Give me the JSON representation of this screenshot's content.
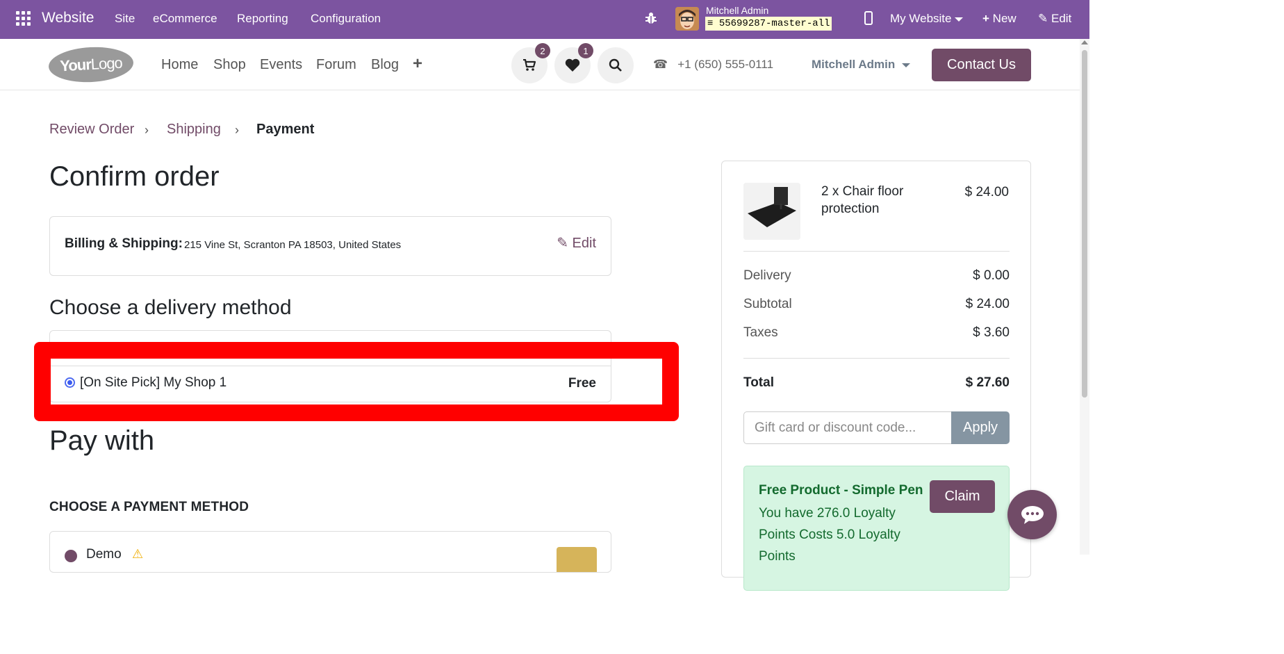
{
  "adminbar": {
    "brand": "Website",
    "menus": [
      "Site",
      "eCommerce",
      "Reporting",
      "Configuration"
    ],
    "user_name": "Mitchell Admin",
    "database": "55699287-master-all",
    "website_switcher": "My Website",
    "new_label": "New",
    "edit_label": "Edit"
  },
  "header": {
    "logo_bold": "Your",
    "logo_light": "Logo",
    "nav": [
      "Home",
      "Shop",
      "Events",
      "Forum",
      "Blog"
    ],
    "cart_count": "2",
    "wishlist_count": "1",
    "phone": "+1 (650) 555-0111",
    "account": "Mitchell Admin",
    "contact_label": "Contact Us"
  },
  "breadcrumb": {
    "step1": "Review Order",
    "step2": "Shipping",
    "step3": "Payment"
  },
  "main": {
    "title": "Confirm order",
    "billing_label": "Billing & Shipping:",
    "billing_address": "215 Vine St, Scranton PA 18503, United States",
    "billing_edit": "Edit",
    "delivery_title": "Choose a delivery method",
    "delivery_method": "[On Site Pick] My Shop 1",
    "delivery_price": "Free",
    "pay_title": "Pay with",
    "payment_subtitle": "CHOOSE A PAYMENT METHOD",
    "payment_option": "Demo"
  },
  "summary": {
    "product_name": "2 x Chair floor protection",
    "product_price": "$ 24.00",
    "delivery_label": "Delivery",
    "delivery_value": "$ 0.00",
    "subtotal_label": "Subtotal",
    "subtotal_value": "$ 24.00",
    "taxes_label": "Taxes",
    "taxes_value": "$ 3.60",
    "total_label": "Total",
    "total_value": "$ 27.60",
    "coupon_placeholder": "Gift card or discount code...",
    "apply_label": "Apply",
    "promo_title": "Free Product - Simple Pen",
    "promo_text": "You have 276.0 Loyalty Points Costs 5.0 Loyalty Points",
    "claim_label": "Claim"
  },
  "colors": {
    "admin_bar": "#7c54a0",
    "brand": "#714b67",
    "highlight": "#ff0000"
  }
}
